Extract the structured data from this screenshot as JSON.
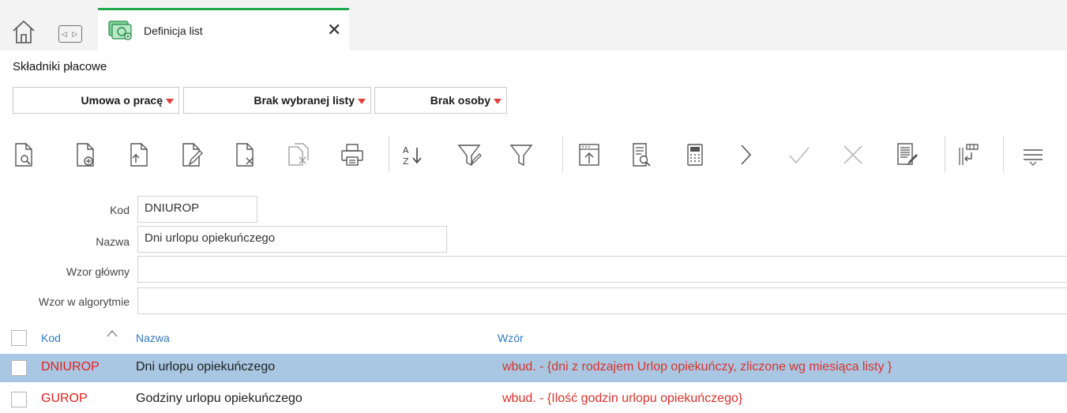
{
  "tabs": {
    "active_title": "Definicja list",
    "nav_arrows": "◁ ▷",
    "close_glyph": "✕"
  },
  "section": {
    "title": "Składniki płacowe"
  },
  "filters": {
    "contract": "Umowa o pracę",
    "list": "Brak wybranej listy",
    "person": "Brak osoby"
  },
  "toolbar": {
    "icons": [
      "preview-document-icon",
      "add-document-icon",
      "import-document-icon",
      "edit-document-icon",
      "delete-document-icon",
      "copy-document-icon",
      "print-icon",
      "sort-az-icon",
      "edit-filter-icon",
      "filter-icon",
      "export-icon",
      "details-icon",
      "calculator-icon",
      "next-icon",
      "accept-icon",
      "cancel-icon",
      "report-edit-icon",
      "columns-icon",
      "menu-icon"
    ]
  },
  "form": {
    "code_label": "Kod",
    "code_value": "DNIUROP",
    "name_label": "Nazwa",
    "name_value": "Dni urlopu opiekuńczego",
    "main_formula_label": "Wzor główny",
    "main_formula_value": "",
    "algorithm_formula_label": "Wzor w algorytmie",
    "algorithm_formula_value": ""
  },
  "grid": {
    "headers": {
      "code": "Kod",
      "name": "Nazwa",
      "formula": "Wzór"
    },
    "rows": [
      {
        "code": "DNIUROP",
        "name": "Dni urlopu opiekuńczego",
        "formula": "wbud. - {dni z rodzajem Urlop opiekuńczy, zliczone wg miesiąca listy }",
        "selected": true
      },
      {
        "code": "GUROP",
        "name": "Godziny urlopu opiekuńczego",
        "formula": "wbud. - {Ilość godzin urlopu opiekuńczego}",
        "selected": false
      }
    ]
  },
  "colors": {
    "accent_green": "#21a94e",
    "selected_row": "#a9c7e2",
    "header_blue": "#2f79c6",
    "code_red": "#e0201c",
    "dropdown_red": "#e0403a"
  }
}
